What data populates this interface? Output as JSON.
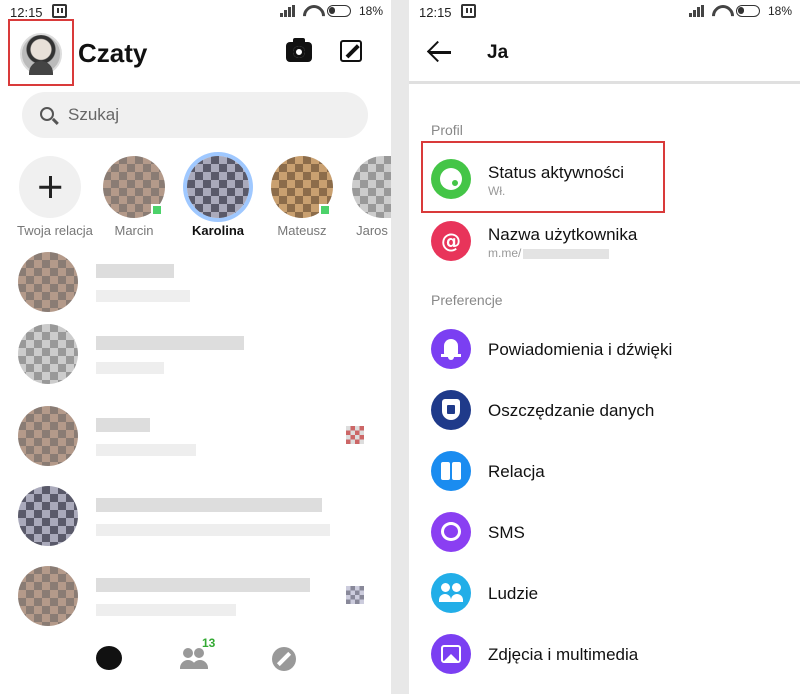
{
  "status_bar": {
    "time": "12:15",
    "battery": "18%"
  },
  "left_screen": {
    "title": "Czaty",
    "search_placeholder": "Szukaj",
    "stories": [
      {
        "label": "Twoja relacja"
      },
      {
        "label": "Marcin"
      },
      {
        "label": "Karolina"
      },
      {
        "label": "Mateusz"
      },
      {
        "label": "Jaros"
      }
    ],
    "nav_badge": "13"
  },
  "right_screen": {
    "title": "Ja",
    "sections": {
      "profile": "Profil",
      "preferences": "Preferencje"
    },
    "items": [
      {
        "label": "Status aktywności",
        "sub": "Wł.",
        "color": "#44c547",
        "icon": "activity-status-icon"
      },
      {
        "label": "Nazwa użytkownika",
        "sub": "m.me/",
        "color": "#e8345a",
        "icon": "at-sign-icon"
      },
      {
        "label": "Powiadomienia i dźwięki",
        "color": "#7b3ff2",
        "icon": "bell-icon"
      },
      {
        "label": "Oszczędzanie danych",
        "color": "#1f3a8a",
        "icon": "shield-data-icon"
      },
      {
        "label": "Relacja",
        "color": "#1a8cf0",
        "icon": "stories-icon"
      },
      {
        "label": "SMS",
        "color": "#8a3ff2",
        "icon": "sms-bubble-icon"
      },
      {
        "label": "Ludzie",
        "color": "#22aee8",
        "icon": "people-icon"
      },
      {
        "label": "Zdjęcia i multimedia",
        "color": "#7b3ff2",
        "icon": "photo-icon"
      }
    ]
  }
}
